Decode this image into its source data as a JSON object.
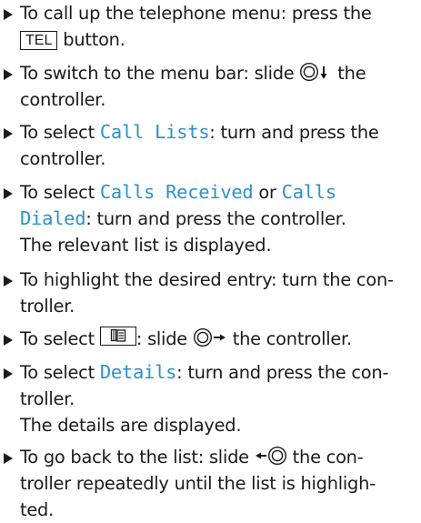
{
  "document": {
    "steps": [
      {
        "p1": "To call up the telephone menu: press the",
        "key": "TEL",
        "p2": "button."
      },
      {
        "p1": "To switch to the menu bar: slide",
        "p2": "the",
        "l2": "controller."
      },
      {
        "p1": "To select",
        "mono": "Call Lists",
        "p2": ": turn and press the",
        "l2": "controller."
      },
      {
        "p1": "To select",
        "mono1": "Calls Received",
        "p2": "or",
        "mono2": "Calls",
        "mono3": "Dialed",
        "p3": ": turn and press the controller.",
        "l3": "The relevant list is displayed."
      },
      {
        "l1": "To highlight the desired entry: turn the con-",
        "l2": "troller."
      },
      {
        "p1": "To select",
        "p2": ": slide",
        "p3": "the controller."
      },
      {
        "p1": "To select",
        "mono": "Details",
        "p2": ": turn and press the con-",
        "l2": "troller.",
        "l3": "The details are displayed."
      },
      {
        "p1": "To go back to the list: slide",
        "p2": "the con-",
        "l2": "troller repeatedly until the list is highligh-",
        "l3": "ted."
      }
    ],
    "icons": {
      "controller": "controller-icon",
      "slide_down": "arrow-down-icon",
      "slide_right": "arrow-right-icon",
      "slide_left": "arrow-left-icon",
      "phonebook": "phonebook-icon"
    },
    "colors": {
      "text": "#1a1a1a",
      "menu_item": "#2693cf"
    }
  }
}
